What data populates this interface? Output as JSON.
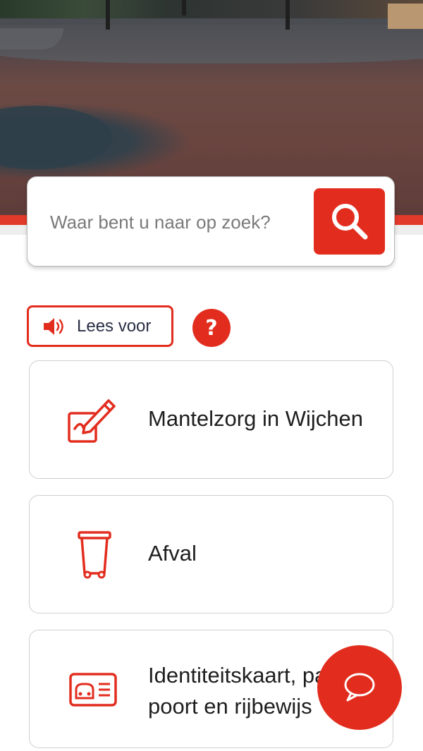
{
  "search": {
    "placeholder": "Waar bent u naar op zoek?",
    "button_icon": "search-icon"
  },
  "toolbar": {
    "read_aloud_label": "Lees voor",
    "read_aloud_icon": "speaker-icon",
    "help_label": "?"
  },
  "tiles": [
    {
      "label": "Mantelzorg in Wijchen",
      "icon": "signature-pencil-icon"
    },
    {
      "label": "Afval",
      "icon": "waste-bin-icon"
    },
    {
      "label_lines": [
        "Identiteitskaart, pas",
        "poort en rijbewijs"
      ],
      "icon": "id-card-icon"
    }
  ],
  "chat": {
    "icon": "chat-bubble-icon"
  },
  "colors": {
    "accent": "#e22d1e",
    "text": "#1e1e1e",
    "border": "#cfcfcf"
  }
}
